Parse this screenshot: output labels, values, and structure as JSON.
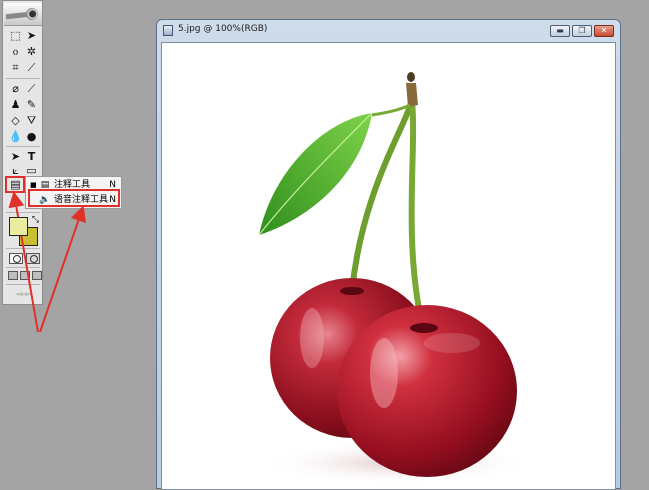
{
  "document": {
    "title": "5.jpg @ 100%(RGB)",
    "window_buttons": {
      "minimize": "minimize-icon",
      "restore": "restore-icon",
      "close": "close-icon"
    }
  },
  "toolbox": {
    "tools": [
      "rect-marquee-icon",
      "move-icon",
      "lasso-icon",
      "magic-wand-icon",
      "crop-icon",
      "slice-icon",
      "healing-brush-icon",
      "brush-icon",
      "clone-stamp-icon",
      "history-brush-icon",
      "eraser-icon",
      "paint-bucket-icon",
      "blur-icon",
      "dodge-icon",
      "path-select-icon",
      "type-icon",
      "pen-icon",
      "shape-icon",
      "notes-icon",
      "eyedropper-icon",
      "hand-icon",
      "zoom-icon"
    ],
    "foreground_color": "#ececa0",
    "background_color": "#c9bd30"
  },
  "flyout": {
    "items": [
      {
        "label": "注释工具",
        "shortcut": "N",
        "icon": "note-icon",
        "active": true
      },
      {
        "label": "语音注释工具",
        "shortcut": "N",
        "icon": "audio-annotation-icon",
        "active": false
      }
    ]
  },
  "annotation": {
    "color": "#e0302a"
  }
}
